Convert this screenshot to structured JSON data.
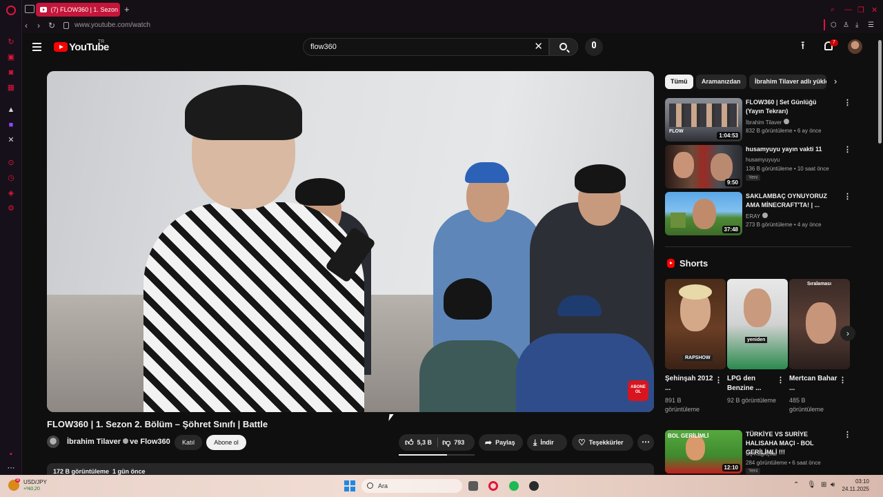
{
  "browser": {
    "tab_title": "(7) FLOW360 | 1. Sezon 2",
    "url": "www.youtube.com/watch"
  },
  "header": {
    "logo_text": "YouTube",
    "region": "TR",
    "search_value": "flow360",
    "notification_count": "7"
  },
  "video": {
    "title": "FLOW360 | 1. Sezon 2. Bölüm – Şöhret Sınıfı | Battle",
    "channel": "İbrahim Tilaver",
    "collab": "ve Flow360",
    "join_label": "Katıl",
    "subscribe_label": "Abone ol",
    "likes": "5,3 B",
    "dislikes": "793",
    "share_label": "Paylaş",
    "download_label": "İndir",
    "thanks_label": "Teşekkürler",
    "sticker_text": "ABONE OL",
    "views": "172 B görüntüleme",
    "age": "1 gün önce"
  },
  "chips": [
    "Tümü",
    "Aramanızdan",
    "İbrahim Tilaver adlı yükle"
  ],
  "recommendations": [
    {
      "title": "FLOW360 | Set Günlüğü (Yayın Tekrarı)",
      "channel": "İbrahim Tilaver",
      "meta": "832 B görüntüleme • 6 ay önce",
      "duration": "1:04:53"
    },
    {
      "title": "husamyuyu yayın vakti 11",
      "channel": "husamyuyuyu",
      "meta": "136 B görüntüleme • 10 saat önce",
      "duration": "9:50",
      "badge": "Yeni"
    },
    {
      "title": "SAKLAMBAÇ OYNUYORUZ AMA MİNECRAFT'TA! | ...",
      "channel": "ERAY",
      "meta": "273 B görüntüleme • 4 ay önce",
      "duration": "37:48"
    }
  ],
  "shorts": {
    "heading": "Shorts",
    "items": [
      {
        "title": "Şehinşah 2012 ...",
        "views": "891 B görüntüleme",
        "caption": "RAPSHOW"
      },
      {
        "title": "LPG den Benzine ...",
        "views": "92 B görüntüleme",
        "caption": "yeniden"
      },
      {
        "title": "Mertcan Bahar ...",
        "views": "485 B görüntüleme",
        "caption": "Sıralaması"
      }
    ]
  },
  "rec4": {
    "title": "TÜRKİYE VS SURİYE HALISAHA MAÇI - BOL GERİLİMLİ !!!",
    "channel": "Üç Kağıtçılar",
    "meta": "284 görüntüleme • 6 saat önce",
    "duration": "12:10",
    "badge": "Yeni"
  },
  "taskbar": {
    "ticker": "USD/JPY",
    "ticker_delta": "+%0,20",
    "search_placeholder": "Ara",
    "time": "03:10",
    "date": "24.11.2025"
  },
  "colors": {
    "accent": "#ff0000",
    "opera": "#e0153a",
    "background": "#0f0f0f"
  }
}
